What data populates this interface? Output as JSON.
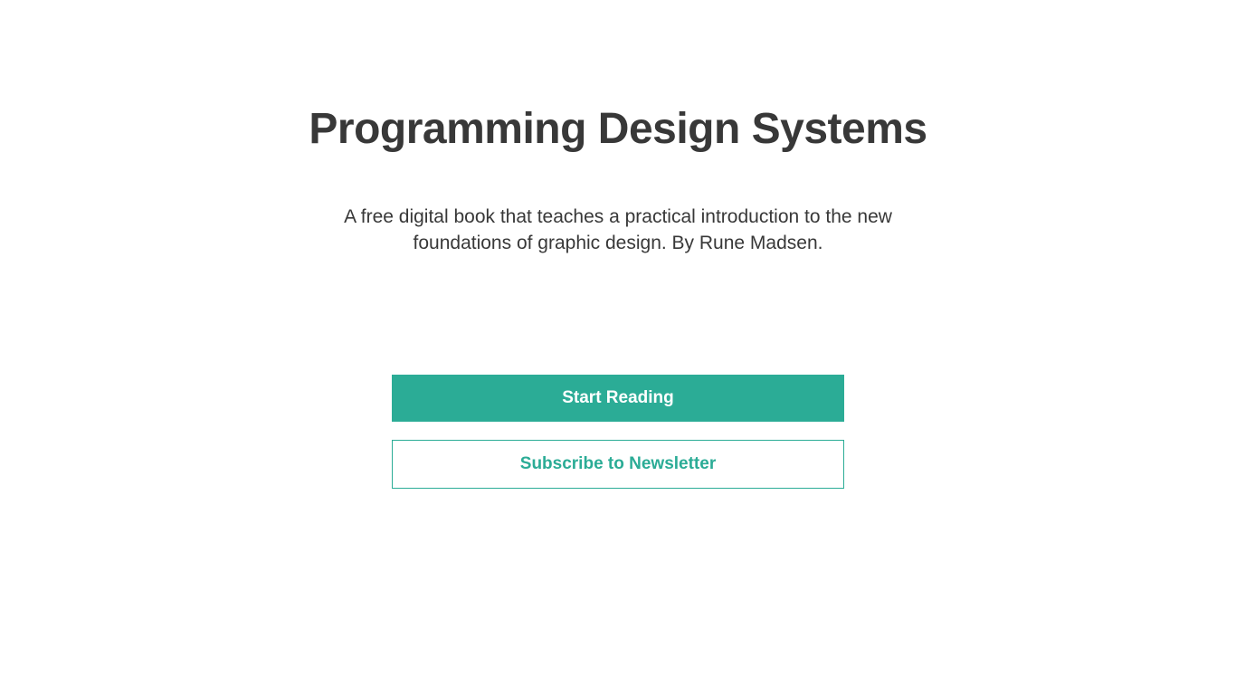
{
  "header": {
    "title": "Programming Design Systems"
  },
  "main": {
    "description": "A free digital book that teaches a practical introduction to the new foundations of graphic design. By Rune Madsen."
  },
  "buttons": {
    "primary_label": "Start Reading",
    "secondary_label": "Subscribe to Newsletter"
  },
  "colors": {
    "accent": "#2bac96",
    "text": "#383838"
  }
}
